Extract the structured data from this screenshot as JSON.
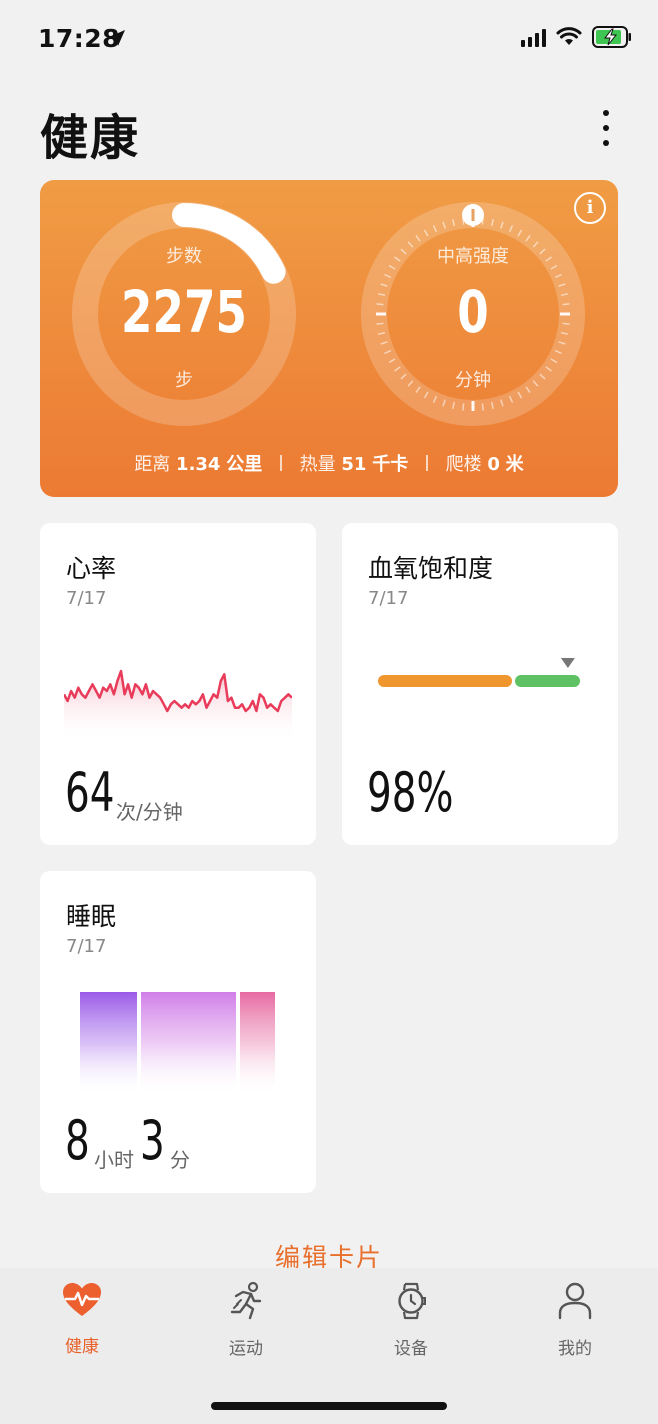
{
  "status_bar": {
    "time": "17:28"
  },
  "header": {
    "title": "健康"
  },
  "activity": {
    "steps": {
      "label": "步数",
      "value": "2275",
      "unit": "步",
      "goal_progress": 0.18
    },
    "intensity": {
      "label": "中高强度",
      "value": "0",
      "unit": "分钟"
    },
    "stats": {
      "distance_label": "距离",
      "distance_value": "1.34",
      "distance_unit": "公里",
      "calories_label": "热量",
      "calories_value": "51",
      "calories_unit": "千卡",
      "floors_label": "爬楼",
      "floors_value": "0",
      "floors_unit": "米"
    },
    "colors": {
      "top": "#f09c45",
      "bottom": "#ec7a33"
    }
  },
  "heart_rate": {
    "title": "心率",
    "date": "7/17",
    "value": "64",
    "unit": "次/分钟",
    "trend": [
      70,
      68,
      71,
      69,
      72,
      70,
      69,
      71,
      73,
      71,
      69,
      72,
      71,
      73,
      70,
      74,
      77,
      70,
      73,
      69,
      73,
      72,
      70,
      73,
      69,
      71,
      70,
      69,
      67,
      65,
      67,
      68,
      67,
      66,
      67,
      66,
      68,
      67,
      68,
      70,
      66,
      68,
      70,
      69,
      74,
      76,
      68,
      69,
      66,
      66,
      67,
      65,
      66,
      68,
      65,
      70,
      69,
      66,
      67,
      66,
      65,
      68,
      69,
      70,
      69
    ],
    "color": "#e83c5a"
  },
  "spo2": {
    "title": "血氧饱和度",
    "date": "7/17",
    "value": "98%",
    "level": 0.94,
    "colors": {
      "low": "#f0962e",
      "normal": "#5ec164"
    }
  },
  "sleep": {
    "title": "睡眠",
    "date": "7/17",
    "hours": "8",
    "hours_unit": "小时",
    "minutes": "3",
    "minutes_unit": "分"
  },
  "edit_cards": "编辑卡片",
  "tabs": [
    {
      "label": "健康",
      "icon": "heart-pulse-icon",
      "active": true
    },
    {
      "label": "运动",
      "icon": "running-icon",
      "active": false
    },
    {
      "label": "设备",
      "icon": "watch-icon",
      "active": false
    },
    {
      "label": "我的",
      "icon": "person-icon",
      "active": false
    }
  ]
}
